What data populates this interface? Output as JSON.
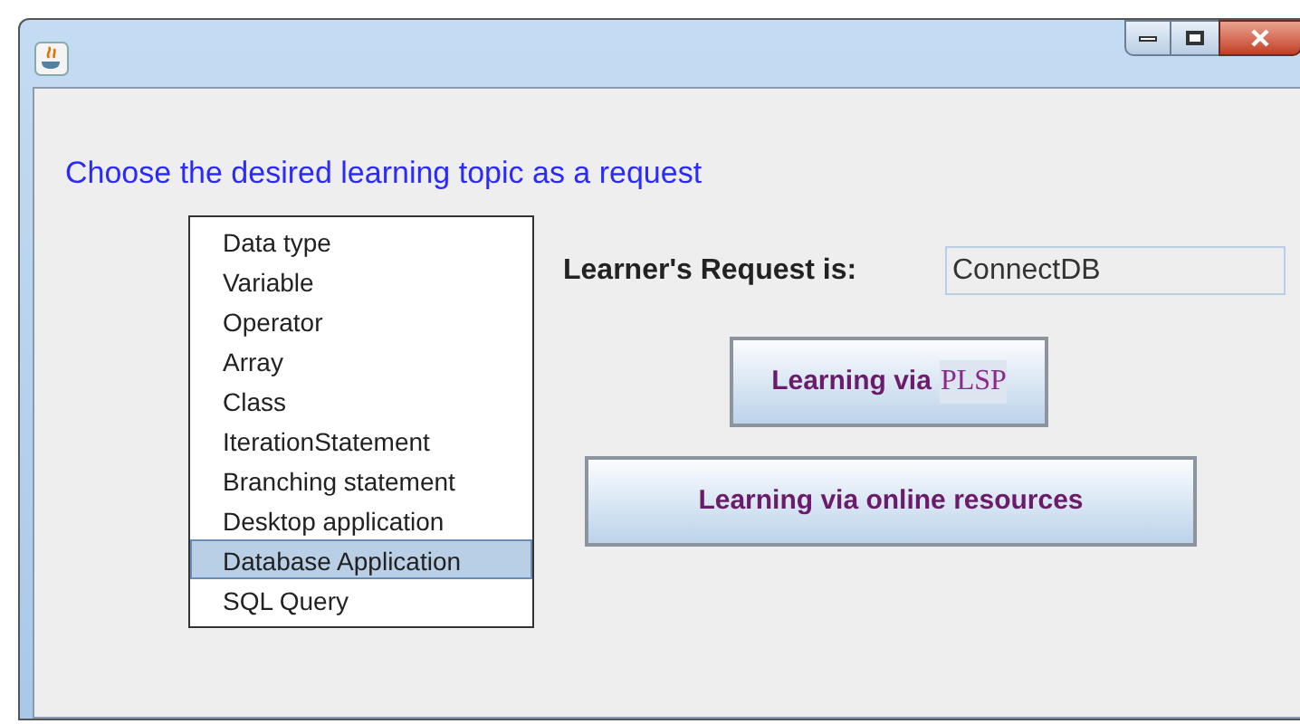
{
  "prompt": "Choose the desired learning topic as a request",
  "topics": [
    {
      "label": "Data type",
      "selected": false
    },
    {
      "label": "Variable",
      "selected": false
    },
    {
      "label": "Operator",
      "selected": false
    },
    {
      "label": "Array",
      "selected": false
    },
    {
      "label": "Class",
      "selected": false
    },
    {
      "label": "IterationStatement",
      "selected": false
    },
    {
      "label": "Branching statement",
      "selected": false
    },
    {
      "label": "Desktop application",
      "selected": false
    },
    {
      "label": "Database Application",
      "selected": true
    },
    {
      "label": "SQL Query",
      "selected": false
    }
  ],
  "request": {
    "label": "Learner's Request is:",
    "value": "ConnectDB"
  },
  "buttons": [
    {
      "label": "Learning via",
      "suffix": "PLSP"
    },
    {
      "label": "Learning via online resources"
    }
  ]
}
